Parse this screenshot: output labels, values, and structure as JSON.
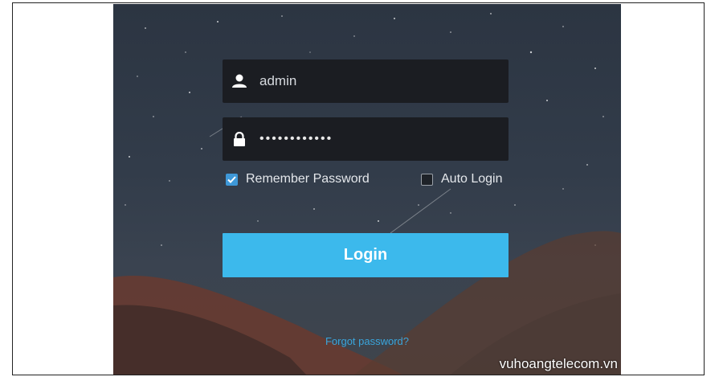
{
  "login_form": {
    "username": "admin",
    "password_masked": "••••••••••••",
    "remember_label": "Remember Password",
    "remember_checked": true,
    "auto_login_label": "Auto Login",
    "auto_login_checked": false,
    "login_label": "Login",
    "forgot_label": "Forgot password?"
  },
  "watermark": "vuhoangtelecom.vn",
  "colors": {
    "accent": "#3cb9ec",
    "checkbox": "#3e98d8",
    "field_bg": "#1b1d22",
    "link": "#3aa5dc"
  },
  "icons": {
    "username": "user-icon",
    "password": "lock-icon"
  }
}
